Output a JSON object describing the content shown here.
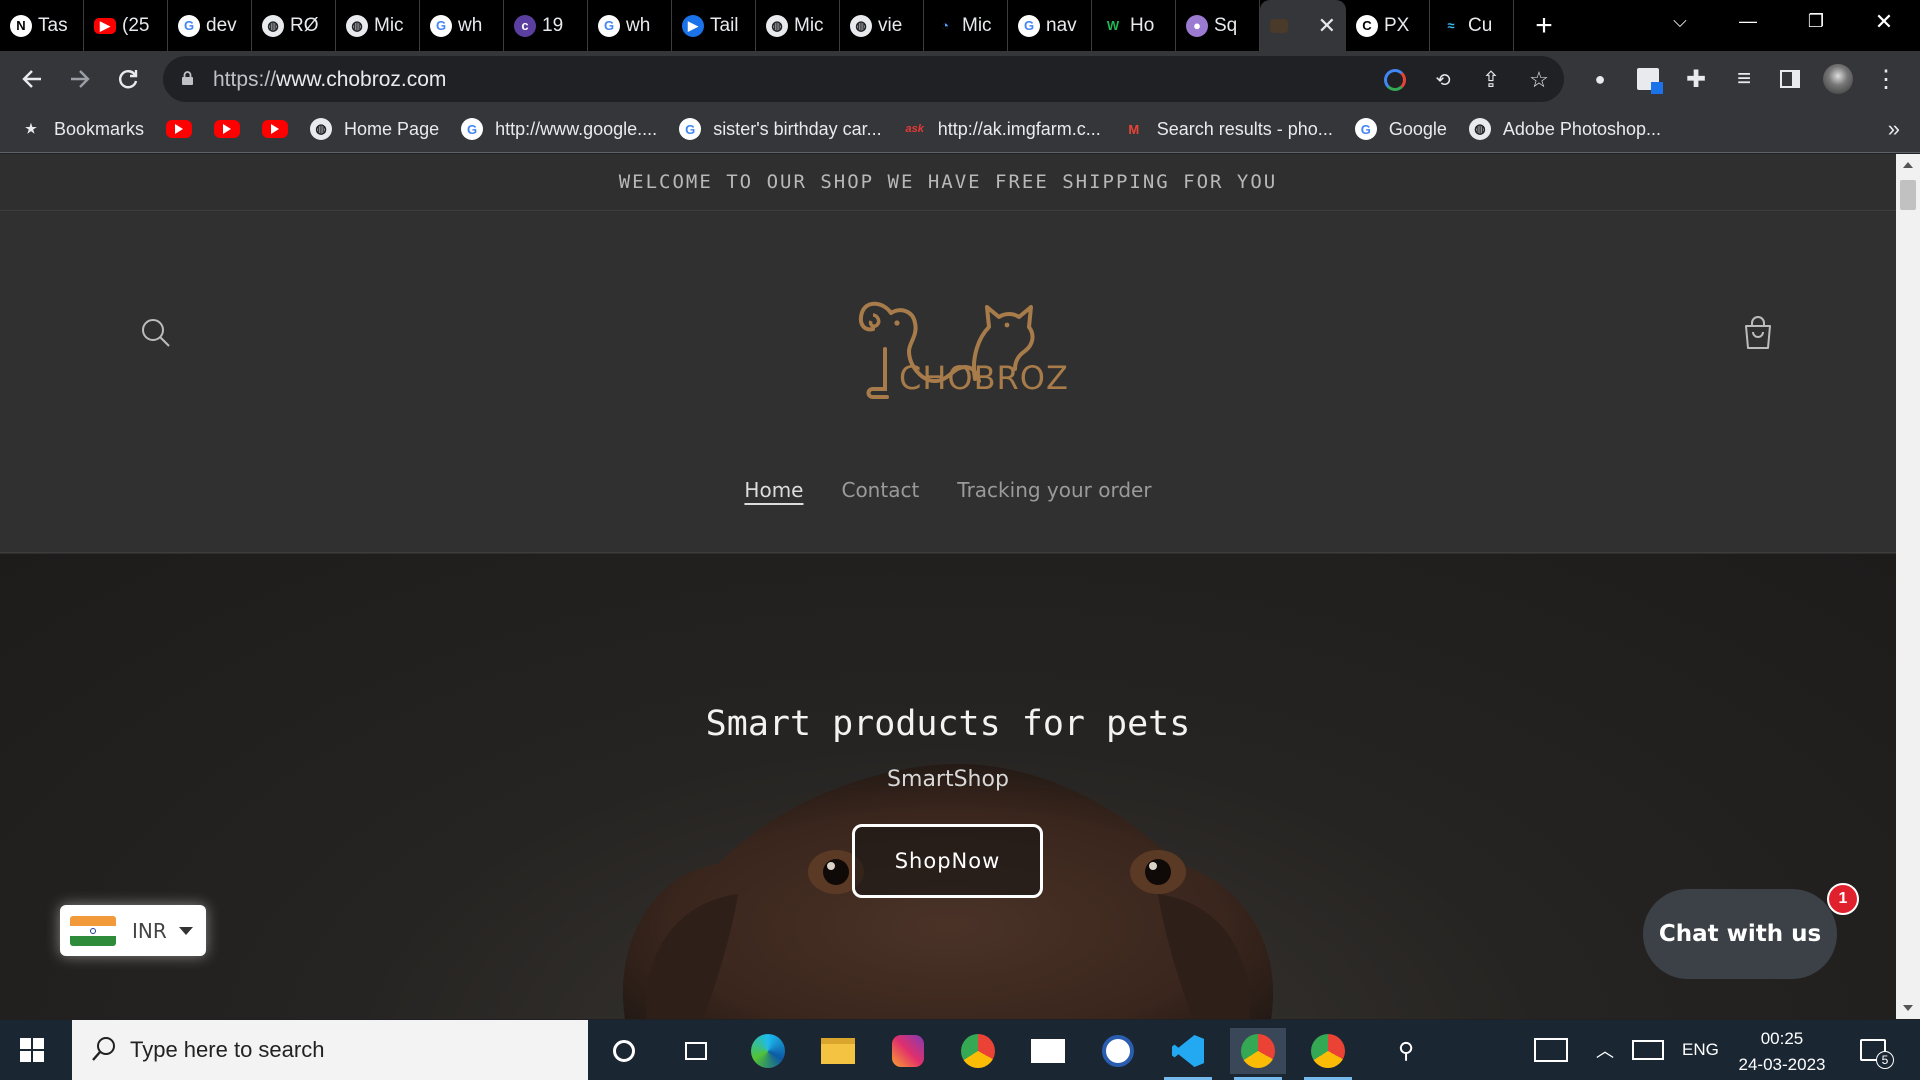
{
  "browser": {
    "tabs": [
      {
        "label": "Tas",
        "icon": "notion-icon"
      },
      {
        "label": "(25",
        "icon": "youtube-icon"
      },
      {
        "label": "dev",
        "icon": "google-icon"
      },
      {
        "label": "RØ",
        "icon": "globe-icon"
      },
      {
        "label": "Mic",
        "icon": "globe-icon"
      },
      {
        "label": "wh",
        "icon": "google-icon"
      },
      {
        "label": "19",
        "icon": "colorlib-icon"
      },
      {
        "label": "wh",
        "icon": "google-icon"
      },
      {
        "label": "Tail",
        "icon": "play-icon"
      },
      {
        "label": "Mic",
        "icon": "globe-icon"
      },
      {
        "label": "vie",
        "icon": "globe-icon"
      },
      {
        "label": "Mic",
        "icon": "loading-icon"
      },
      {
        "label": "nav",
        "icon": "google-icon"
      },
      {
        "label": "Ho",
        "icon": "w-icon"
      },
      {
        "label": "Sq",
        "icon": "avatar-icon"
      }
    ],
    "active_tab": {
      "label": "",
      "icon": "chobroz-favicon"
    },
    "tabs_after": [
      {
        "label": "PX",
        "icon": "px-icon"
      },
      {
        "label": "Cu",
        "icon": "tailwind-icon"
      }
    ],
    "url": {
      "scheme": "https://",
      "host": "www.chobroz.com"
    },
    "bookmarks": [
      {
        "label": "Bookmarks",
        "icon": "star-icon"
      },
      {
        "label": "",
        "icon": "youtube-icon"
      },
      {
        "label": "",
        "icon": "youtube-icon"
      },
      {
        "label": "",
        "icon": "youtube-icon"
      },
      {
        "label": "Home Page",
        "icon": "globe-icon"
      },
      {
        "label": "http://www.google....",
        "icon": "google-icon"
      },
      {
        "label": "sister's birthday car...",
        "icon": "google-icon"
      },
      {
        "label": "http://ak.imgfarm.c...",
        "icon": "ask-icon"
      },
      {
        "label": "Search results - pho...",
        "icon": "gmail-icon"
      },
      {
        "label": "Google",
        "icon": "google-icon"
      },
      {
        "label": "Adobe Photoshop...",
        "icon": "globe-icon"
      }
    ],
    "overflow": "»"
  },
  "site": {
    "announcement": "WELCOME TO OUR SHOP WE HAVE FREE SHIPPING FOR YOU",
    "logo_text": "CHOBROZ",
    "nav": [
      "Home",
      "Contact",
      "Tracking your order"
    ],
    "hero": {
      "title": "Smart products for pets",
      "subtitle": "SmartShop",
      "button": "ShopNow"
    },
    "currency": "INR",
    "chat": {
      "label": "Chat with us",
      "badge": "1"
    }
  },
  "taskbar": {
    "search_placeholder": "Type here to search",
    "language": "ENG",
    "time": "00:25",
    "date": "24-03-2023",
    "notifications": "5"
  },
  "colors": {
    "page_bg": "#303030",
    "logo_brown": "#a87c4a",
    "chat_bg": "#3c4148",
    "badge_red": "#e0202c",
    "taskbar_bg": "#1b2633"
  }
}
